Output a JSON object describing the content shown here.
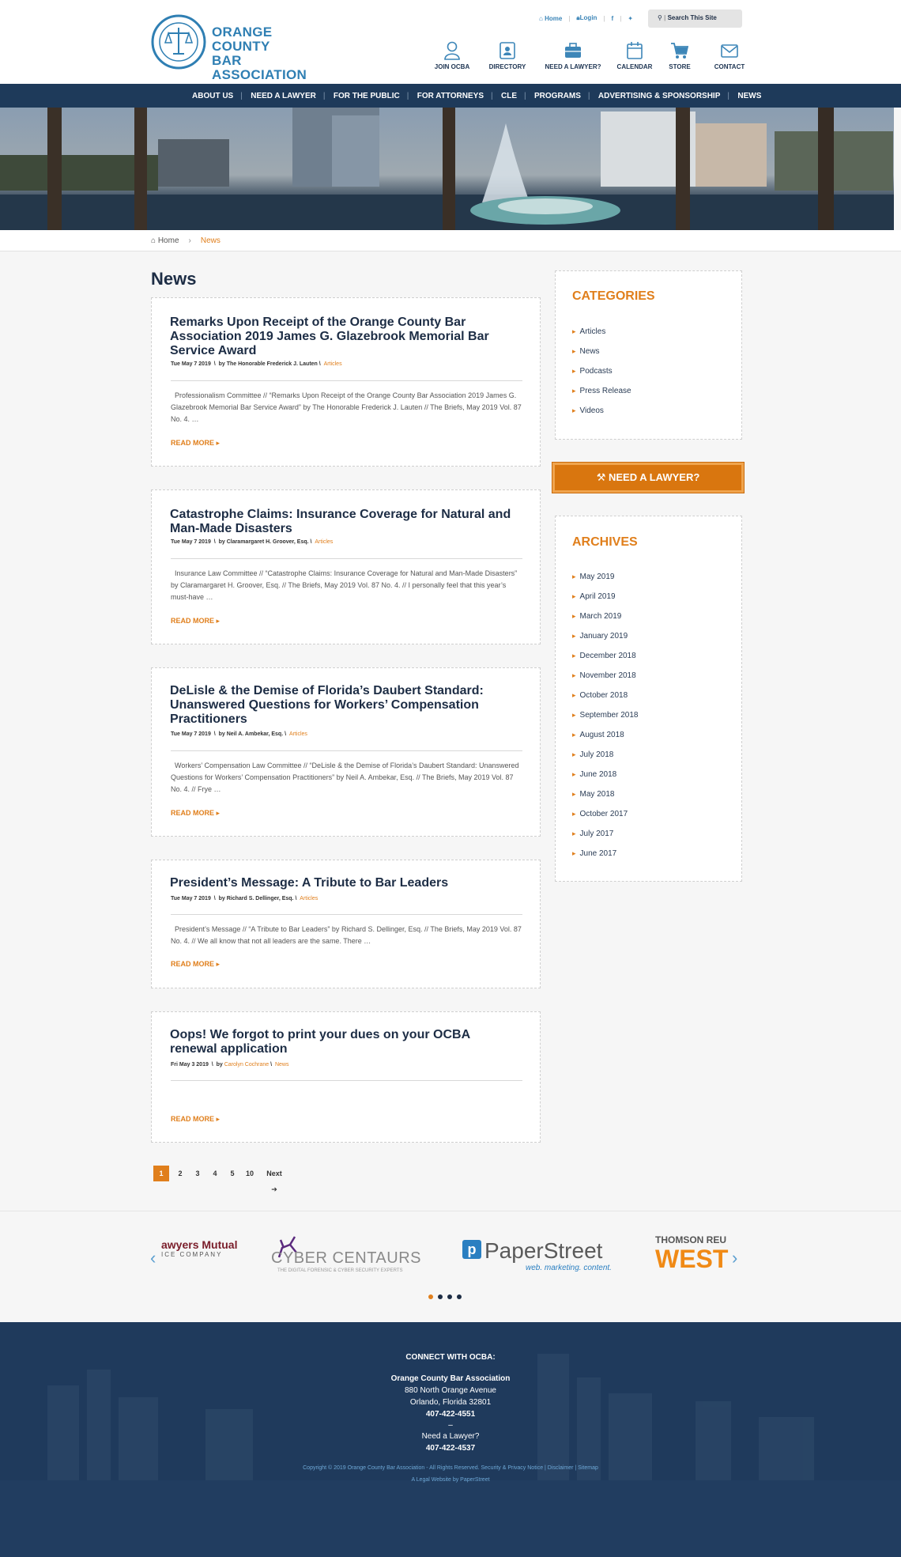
{
  "header": {
    "logo_line1": "ORANGE COUNTY",
    "logo_line2": "BAR ASSOCIATION",
    "top_links": {
      "home": "Home",
      "login": "Login"
    },
    "search_label": "Search This Site",
    "icon_nav": [
      {
        "label": "JOIN OCBA",
        "icon": "user-icon"
      },
      {
        "label": "DIRECTORY",
        "icon": "directory-icon"
      },
      {
        "label": "NEED A LAWYER?",
        "icon": "briefcase-icon"
      },
      {
        "label": "CALENDAR",
        "icon": "calendar-icon"
      },
      {
        "label": "STORE",
        "icon": "cart-icon"
      },
      {
        "label": "CONTACT",
        "icon": "envelope-icon"
      }
    ]
  },
  "nav": [
    "ABOUT US",
    "NEED A LAWYER",
    "FOR THE PUBLIC",
    "FOR ATTORNEYS",
    "CLE",
    "PROGRAMS",
    "ADVERTISING & SPONSORSHIP",
    "NEWS"
  ],
  "breadcrumb": {
    "home": "Home",
    "current": "News"
  },
  "page_title": "News",
  "posts": [
    {
      "title": "Remarks Upon Receipt of the Orange County Bar Association 2019 James G. Glazebrook Memorial Bar Service Award",
      "date": "Tue May 7 2019",
      "by": "by The Honorable Frederick J. Lauten",
      "category": "Articles",
      "excerpt": "Professionalism Committee // “Remarks Upon Receipt of the Orange County Bar Association 2019 James G. Glazebrook Memorial Bar Service Award” by The Honorable Frederick J. Lauten // The Briefs, May 2019 Vol. 87 No. 4. …",
      "more": "READ MORE"
    },
    {
      "title": "Catastrophe Claims: Insurance Coverage for Natural and Man-Made Disasters",
      "date": "Tue May 7 2019",
      "by": "by Claramargaret H. Groover, Esq.",
      "category": "Articles",
      "excerpt": "Insurance Law Committee // “Catastrophe Claims: Insurance Coverage for Natural and Man-Made Disasters” by Claramargaret H. Groover, Esq. // The Briefs, May 2019 Vol. 87 No. 4. // I personally feel that this year’s must-have …",
      "more": "READ MORE"
    },
    {
      "title": "DeLisle & the Demise of Florida’s Daubert Standard: Unanswered Questions for Workers’ Compensation Practitioners",
      "date": "Tue May 7 2019",
      "by": "by Neil A. Ambekar, Esq.",
      "category": "Articles",
      "excerpt": "Workers’ Compensation Law Committee // “DeLisle & the Demise of Florida’s Daubert Standard: Unanswered Questions for Workers’ Compensation Practitioners” by Neil A. Ambekar, Esq. // The Briefs, May 2019 Vol. 87 No. 4. // Frye …",
      "more": "READ MORE"
    },
    {
      "title": "President’s Message: A Tribute to Bar Leaders",
      "date": "Tue May 7 2019",
      "by": "by Richard S. Dellinger, Esq.",
      "category": "Articles",
      "excerpt": "President’s Message // “A Tribute to Bar Leaders” by Richard S. Dellinger, Esq. // The Briefs, May 2019 Vol. 87 No. 4. // We all know that not all leaders are the same. There …",
      "more": "READ MORE"
    },
    {
      "title": "Oops! We forgot to print your dues on your OCBA renewal application",
      "date": "Fri May 3 2019",
      "by_prefix": "by",
      "author": "Carolyn Cochrane",
      "category": "News",
      "excerpt": "",
      "more": "READ MORE"
    }
  ],
  "pagination": [
    "1",
    "2",
    "3",
    "4",
    "5",
    "10",
    "Next"
  ],
  "sidebar": {
    "categories_title": "CATEGORIES",
    "categories": [
      "Articles",
      "News",
      "Podcasts",
      "Press Release",
      "Videos"
    ],
    "lawyer_button": "NEED A LAWYER?",
    "archives_title": "ARCHIVES",
    "archives": [
      "May 2019",
      "April 2019",
      "March 2019",
      "January 2019",
      "December 2018",
      "November 2018",
      "October 2018",
      "September 2018",
      "August 2018",
      "July 2018",
      "June 2018",
      "May 2018",
      "October 2017",
      "July 2017",
      "June 2017"
    ]
  },
  "sponsors": {
    "lawyers_mutual_1": "awyers Mutual",
    "lawyers_mutual_2": "ICE COMPANY",
    "cyber_name": "CYBER CENTAURS",
    "cyber_tag": "THE DIGITAL FORENSIC & CYBER SECURITY EXPERTS",
    "paperstreet_name": "PaperStreet",
    "paperstreet_tag": "web. marketing. content.",
    "thomson": "THOMSON REU",
    "west": "WEST"
  },
  "footer": {
    "connect": "CONNECT WITH OCBA:",
    "org": "Orange County Bar Association",
    "address1": "880 North Orange Avenue",
    "address2": "Orlando, Florida 32801",
    "phone": "407-422-4551",
    "dash": "–",
    "need_lawyer": "Need a Lawyer?",
    "lawyer_phone": "407-422-4537",
    "copyright": "Copyright © 2019 Orange County Bar Association - All Rights Reserved. Security & Privacy Notice | Disclaimer | Sitemap",
    "credit": "A Legal Website by PaperStreet"
  },
  "colors": {
    "accent": "#e07f1c",
    "navy": "#1e3a5a",
    "link_blue": "#2f7fb3"
  }
}
